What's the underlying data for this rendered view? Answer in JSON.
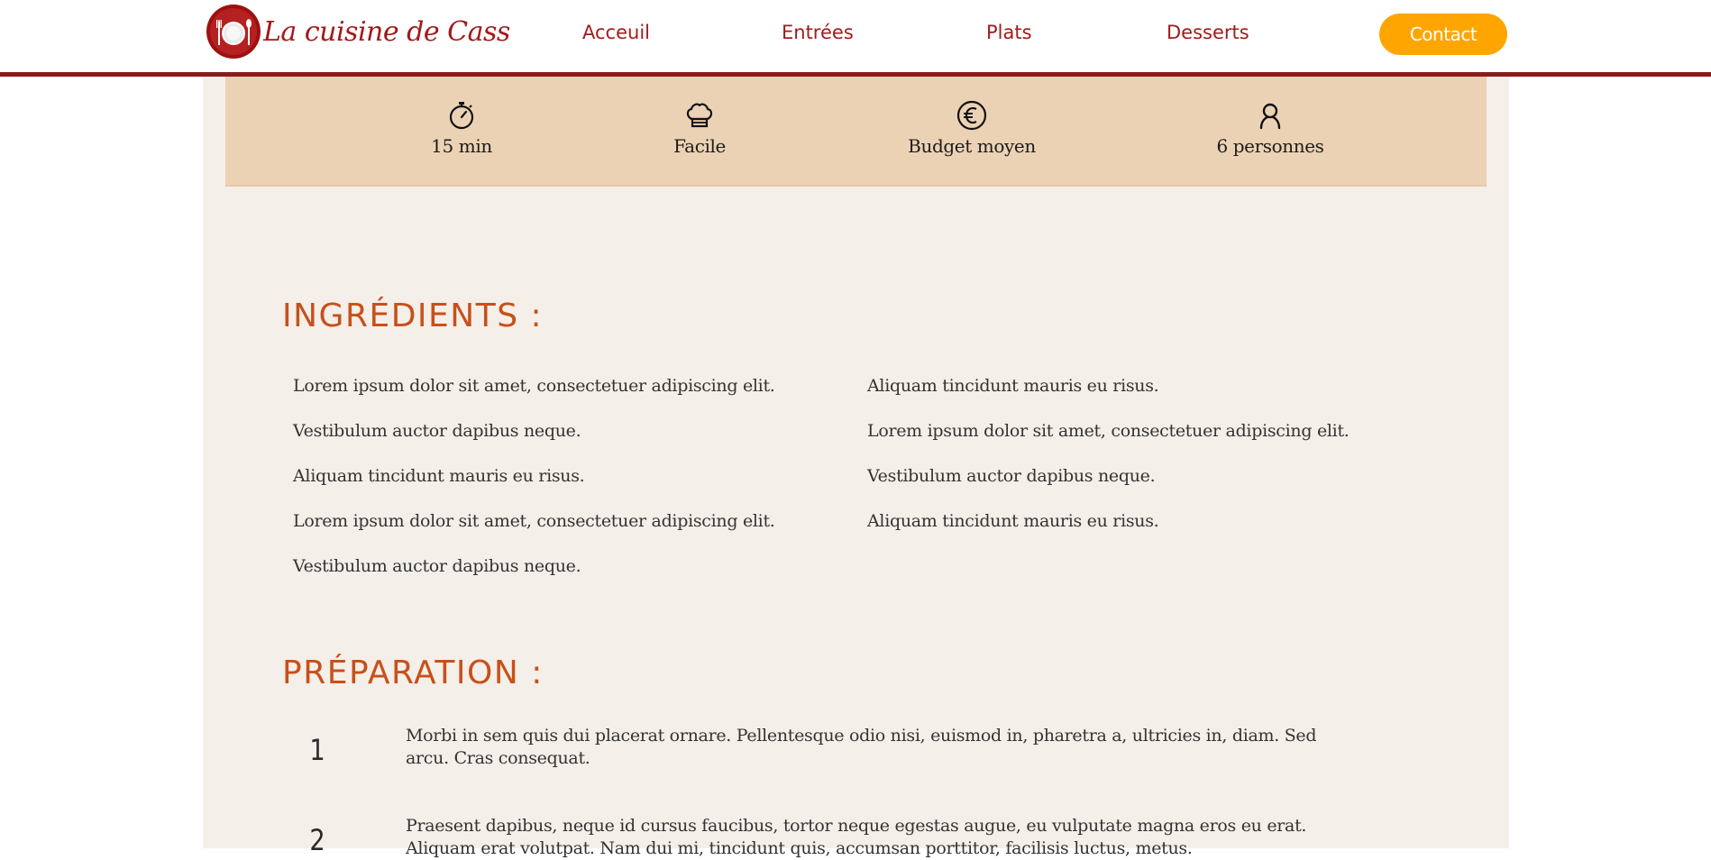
{
  "header": {
    "logo_text": "La cuisine de Cass",
    "nav": [
      "Acceuil",
      "Entrées",
      "Plats",
      "Desserts"
    ],
    "contact_label": "Contact",
    "colors": {
      "brand": "#a31b1b",
      "accent": "#ffa500"
    }
  },
  "info": [
    {
      "icon": "stopwatch-icon",
      "text": "15 min"
    },
    {
      "icon": "chef-hat-icon",
      "text": "Facile"
    },
    {
      "icon": "euro-icon",
      "text": "Budget moyen"
    },
    {
      "icon": "person-icon",
      "text": "6 personnes"
    }
  ],
  "ingredients": {
    "title": "INGRÉDIENTS :",
    "left": [
      "Lorem ipsum dolor sit amet, consectetuer adipiscing elit.",
      "Vestibulum auctor dapibus neque.",
      "Aliquam tincidunt mauris eu risus.",
      "Lorem ipsum dolor sit amet, consectetuer adipiscing elit.",
      "Vestibulum auctor dapibus neque."
    ],
    "right": [
      "Aliquam tincidunt mauris eu risus.",
      "Lorem ipsum dolor sit amet, consectetuer adipiscing elit.",
      "Vestibulum auctor dapibus neque.",
      "Aliquam tincidunt mauris eu risus."
    ]
  },
  "preparation": {
    "title": "PRÉPARATION :",
    "steps": [
      {
        "num": "1",
        "text": "Morbi in sem quis dui placerat ornare. Pellentesque odio nisi, euismod in, pharetra a, ultricies in, diam. Sed arcu. Cras consequat."
      },
      {
        "num": "2",
        "text": "Praesent dapibus, neque id cursus faucibus, tortor neque egestas augue, eu vulputate magna eros eu erat. Aliquam erat volutpat. Nam dui mi, tincidunt quis, accumsan porttitor, facilisis luctus, metus."
      }
    ]
  }
}
